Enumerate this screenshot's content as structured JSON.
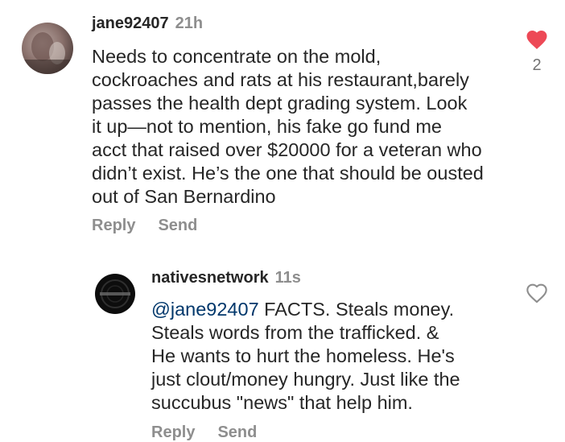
{
  "comments": [
    {
      "username": "jane92407",
      "time": "21h",
      "lines": [
        "Needs to concentrate on the mold,",
        "cockroaches and rats at his restaurant,barely",
        "passes the health dept grading system. Look",
        "it up—not to mention, his fake go fund me",
        "acct that raised over $20000 for a veteran who",
        "didn’t exist. He’s the one that should be ousted",
        "out of San Bernardino"
      ],
      "reply_label": "Reply",
      "send_label": "Send",
      "like_count": "2",
      "liked": true,
      "like_color": "#ed4956"
    },
    {
      "username": "nativesnetwork",
      "time": "11s",
      "mention": "@jane92407",
      "lines": [
        " FACTS. Steals money.",
        "Steals words from the trafficked. &",
        "He wants to hurt the homeless. He's",
        "just clout/money hungry. Just like the",
        "succubus \"news\" that help him."
      ],
      "reply_label": "Reply",
      "send_label": "Send",
      "liked": false
    }
  ],
  "colors": {
    "primary_text": "#262626",
    "secondary_text": "#8e8e8e",
    "mention": "#00376b",
    "heart_filled": "#ed4956"
  },
  "icons": {
    "like_filled": "heart-filled-icon",
    "like_outline": "heart-outline-icon"
  }
}
